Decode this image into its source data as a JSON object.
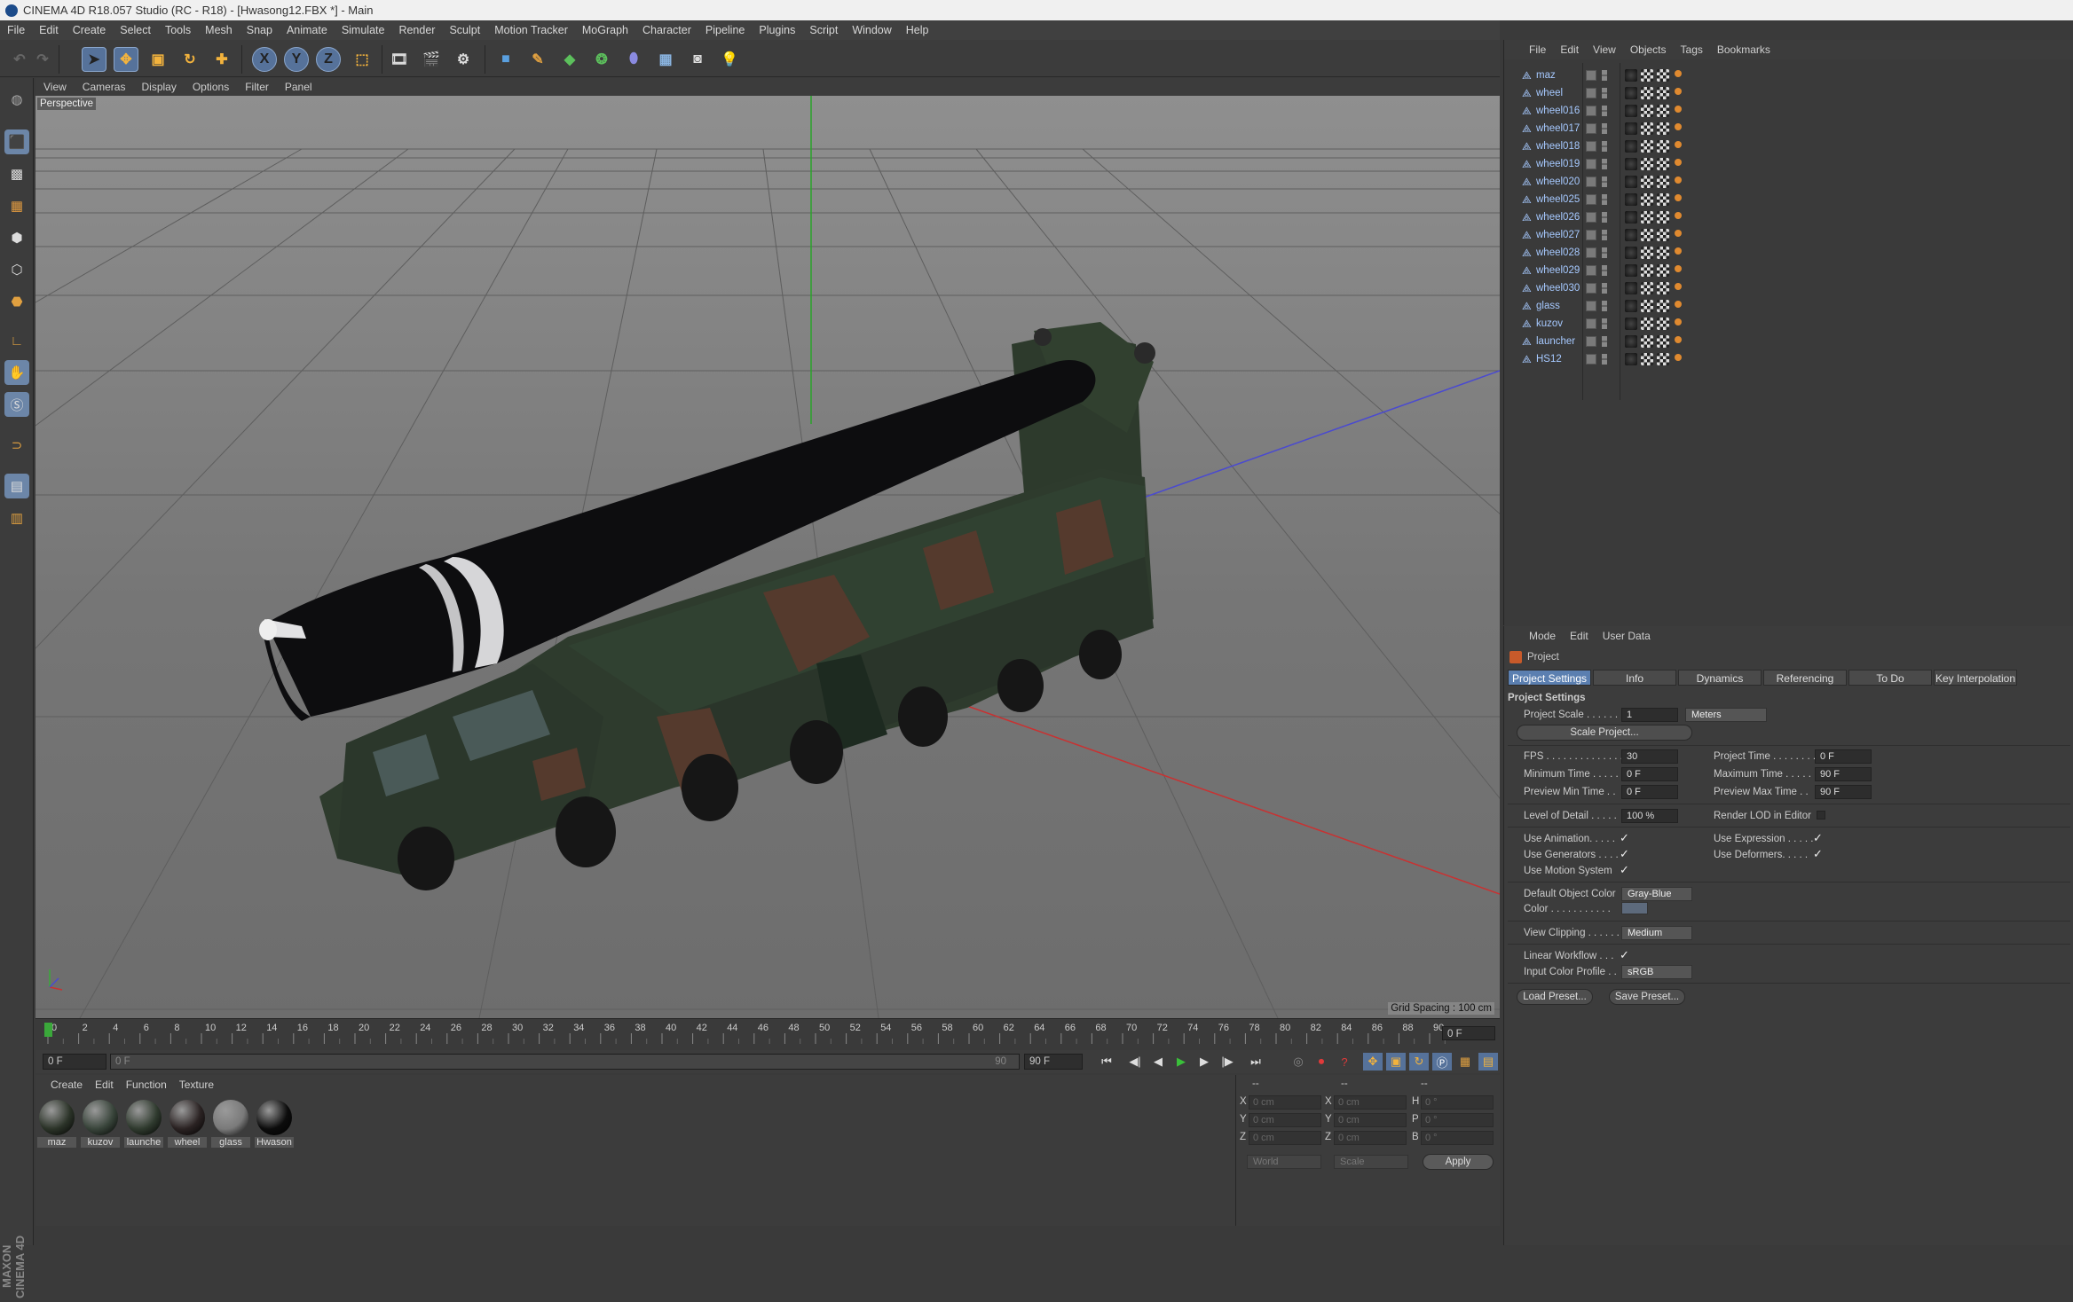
{
  "window_title": "CINEMA 4D R18.057 Studio (RC - R18) - [Hwasong12.FBX *] - Main",
  "menu": [
    "File",
    "Edit",
    "Create",
    "Select",
    "Tools",
    "Mesh",
    "Snap",
    "Animate",
    "Simulate",
    "Render",
    "Sculpt",
    "Motion Tracker",
    "MoGraph",
    "Character",
    "Pipeline",
    "Plugins",
    "Script",
    "Window",
    "Help"
  ],
  "toolbar_icons": [
    "undo-icon",
    "redo-icon",
    "select-arrow-icon",
    "move-icon",
    "scale-icon",
    "rotate-icon",
    "cross-move-icon",
    "x-axis-icon",
    "y-axis-icon",
    "z-axis-icon",
    "coordinate-system-icon",
    "render-view-icon",
    "render-picture-viewer-icon",
    "render-settings-icon",
    "cube-icon",
    "pen-icon",
    "subdivision-icon",
    "array-icon",
    "deformer-icon",
    "floor-icon",
    "camera-icon",
    "light-icon"
  ],
  "axis_labels": {
    "x": "X",
    "y": "Y",
    "z": "Z"
  },
  "viewport": {
    "menu": [
      "View",
      "Cameras",
      "Display",
      "Options",
      "Filter",
      "Panel"
    ],
    "camera_label": "Perspective",
    "grid_spacing": "Grid Spacing : 100 cm"
  },
  "timeline": {
    "ticks": [
      "0",
      "2",
      "4",
      "6",
      "8",
      "10",
      "12",
      "14",
      "16",
      "18",
      "20",
      "22",
      "24",
      "26",
      "28",
      "30",
      "32",
      "34",
      "36",
      "38",
      "40",
      "42",
      "44",
      "46",
      "48",
      "50",
      "52",
      "54",
      "56",
      "58",
      "60",
      "62",
      "64",
      "66",
      "68",
      "70",
      "72",
      "74",
      "76",
      "78",
      "80",
      "82",
      "84",
      "86",
      "88",
      "90"
    ],
    "current_frame": "0 F",
    "start_field": "0 F",
    "range_start": "0 F",
    "range_end_label": "90",
    "end_field": "90 F"
  },
  "materials": {
    "menu": [
      "Create",
      "Edit",
      "Function",
      "Texture"
    ],
    "items": [
      {
        "name": "maz",
        "color": "#2b3328"
      },
      {
        "name": "kuzov",
        "color": "#38443a"
      },
      {
        "name": "launche",
        "color": "#2f3a2e"
      },
      {
        "name": "wheel",
        "color": "#2a2222"
      },
      {
        "name": "glass",
        "color": "#7a7a7a"
      },
      {
        "name": "Hwason",
        "color": "#0c0c0c"
      }
    ]
  },
  "coordinates": {
    "header": [
      "--",
      "--",
      "--"
    ],
    "rows": [
      {
        "a": "X",
        "av": "0 cm",
        "b": "X",
        "bv": "0 cm",
        "c": "H",
        "cv": "0 °"
      },
      {
        "a": "Y",
        "av": "0 cm",
        "b": "Y",
        "bv": "0 cm",
        "c": "P",
        "cv": "0 °"
      },
      {
        "a": "Z",
        "av": "0 cm",
        "b": "Z",
        "bv": "0 cm",
        "c": "B",
        "cv": "0 °"
      }
    ],
    "world": "World",
    "scale": "Scale",
    "apply": "Apply"
  },
  "objects": {
    "menu": [
      "File",
      "Edit",
      "View",
      "Objects",
      "Tags",
      "Bookmarks"
    ],
    "items": [
      "maz",
      "wheel",
      "wheel016",
      "wheel017",
      "wheel018",
      "wheel019",
      "wheel020",
      "wheel025",
      "wheel026",
      "wheel027",
      "wheel028",
      "wheel029",
      "wheel030",
      "glass",
      "kuzov",
      "launcher",
      "HS12"
    ]
  },
  "attributes": {
    "menu": [
      "Mode",
      "Edit",
      "User Data"
    ],
    "title": "Project",
    "tabs": [
      "Project Settings",
      "Info",
      "Dynamics",
      "Referencing",
      "To Do",
      "Key Interpolation"
    ],
    "section": "Project Settings",
    "project_scale_label": "Project Scale . . . . . .",
    "project_scale": "1",
    "project_scale_unit": "Meters",
    "scale_project_button": "Scale Project...",
    "fps_label": "FPS . . . . . . . . . . . . . .",
    "fps": "30",
    "project_time_label": "Project Time . . . . . . . .",
    "project_time": "0 F",
    "min_time_label": "Minimum Time . . . . .",
    "min_time": "0 F",
    "max_time_label": "Maximum Time . . . . .",
    "max_time": "90 F",
    "prev_min_label": "Preview Min Time . .",
    "prev_min": "0 F",
    "prev_max_label": "Preview Max Time . .",
    "prev_max": "90 F",
    "lod_label": "Level of Detail . . . . .",
    "lod": "100 %",
    "render_lod_label": "Render LOD in Editor",
    "use_animation": "Use Animation. . . . .",
    "use_expression": "Use Expression . . . . .",
    "use_generators": "Use Generators . . . .",
    "use_deformers": "Use Deformers. . . . .",
    "use_motion": "Use Motion System",
    "default_color_label": "Default Object Color",
    "default_color": "Gray-Blue",
    "color_label": "Color . . . . . . . . . . .",
    "view_clipping_label": "View Clipping . . . . . .",
    "view_clipping": "Medium",
    "linear_workflow": "Linear Workflow . . .",
    "input_color_label": "Input Color Profile . .",
    "input_color": "sRGB",
    "load_preset": "Load Preset...",
    "save_preset": "Save Preset..."
  },
  "colors": {
    "accent": "#5b7fb0",
    "object_name": "#a6c9ff",
    "camo_green": "#2d3a2c",
    "camo_brown": "#5a3c2e"
  }
}
